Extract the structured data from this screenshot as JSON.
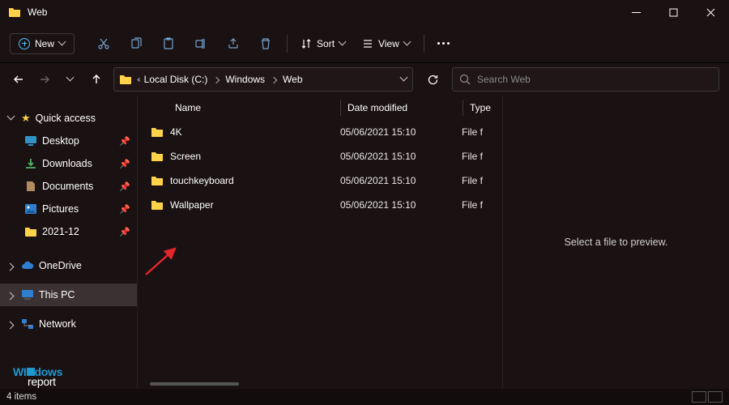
{
  "window": {
    "title": "Web"
  },
  "toolbar": {
    "new_label": "New",
    "sort_label": "Sort",
    "view_label": "View"
  },
  "breadcrumbs": {
    "disk": "Local Disk (C:)",
    "folder1": "Windows",
    "folder2": "Web"
  },
  "search": {
    "placeholder": "Search Web"
  },
  "sidebar": {
    "quick": "Quick access",
    "desktop": "Desktop",
    "downloads": "Downloads",
    "documents": "Documents",
    "pictures": "Pictures",
    "recent": "2021-12",
    "onedrive": "OneDrive",
    "thispc": "This PC",
    "network": "Network"
  },
  "columns": {
    "name": "Name",
    "date": "Date modified",
    "type": "Type"
  },
  "rows": [
    {
      "name": "4K",
      "date": "05/06/2021 15:10",
      "type": "File f"
    },
    {
      "name": "Screen",
      "date": "05/06/2021 15:10",
      "type": "File f"
    },
    {
      "name": "touchkeyboard",
      "date": "05/06/2021 15:10",
      "type": "File f"
    },
    {
      "name": "Wallpaper",
      "date": "05/06/2021 15:10",
      "type": "File f"
    }
  ],
  "preview": {
    "empty": "Select a file to preview."
  },
  "status": {
    "count": "4 items"
  }
}
